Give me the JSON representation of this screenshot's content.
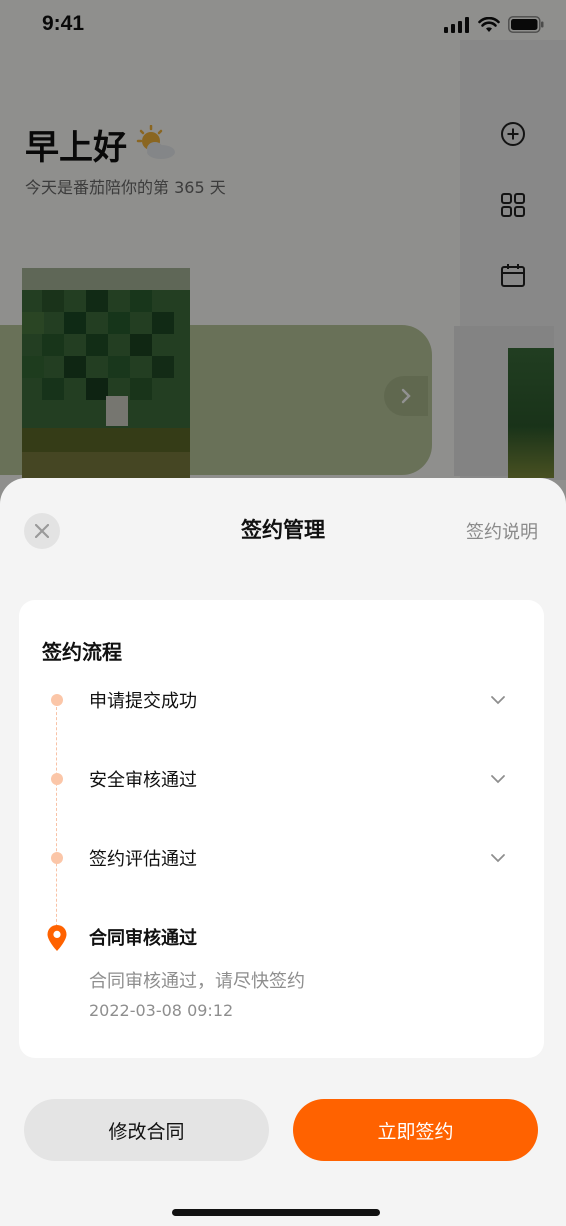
{
  "status_bar": {
    "time": "9:41"
  },
  "home": {
    "greeting": "早上好",
    "subtitle": "今天是番茄陪你的第 365 天",
    "side_icons": [
      "add-circle-icon",
      "grid-icon",
      "calendar-icon"
    ]
  },
  "sheet": {
    "title": "签约管理",
    "help_link": "签约说明",
    "flow": {
      "heading": "签约流程",
      "steps": [
        {
          "label": "申请提交成功"
        },
        {
          "label": "安全审核通过"
        },
        {
          "label": "签约评估通过"
        },
        {
          "label": "合同审核通过",
          "description": "合同审核通过，请尽快签约",
          "time": "2022-03-08 09:12"
        }
      ]
    },
    "buttons": {
      "edit": "修改合同",
      "sign": "立即签约"
    }
  },
  "colors": {
    "accent": "#ff6200",
    "timeline": "#fbc6a8"
  }
}
